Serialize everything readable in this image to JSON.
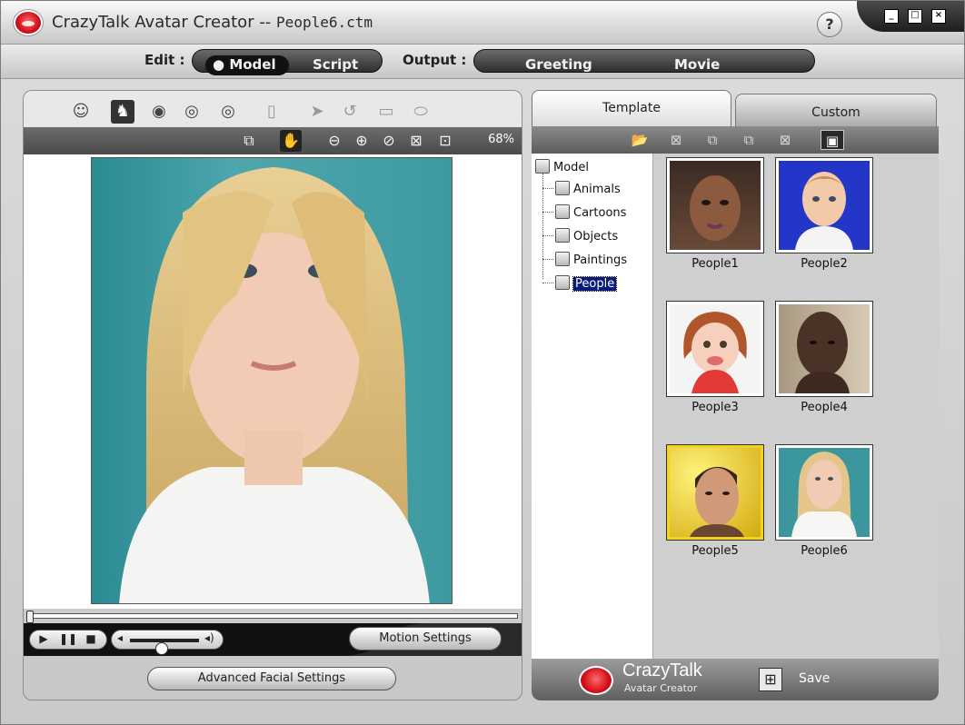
{
  "app": {
    "title_prefix": "CrazyTalk Avatar Creator --",
    "filename": "People6.ctm",
    "help_label": "?",
    "min_label": "_",
    "max_label": "□",
    "close_label": "×"
  },
  "nav": {
    "edit_label": "Edit :",
    "model_label": "Model",
    "script_label": "Script",
    "output_label": "Output :",
    "greeting_label": "Greeting",
    "movie_label": "Movie"
  },
  "editor": {
    "toolbar_icons": [
      "face-icon",
      "face-outline-icon",
      "eye-icon",
      "eyes-icon",
      "eyes-alt-icon",
      "page-icon",
      "cursor-icon",
      "rotate-icon",
      "crop-icon",
      "mouth-icon"
    ],
    "view_icons": [
      "fit-view-icon",
      "hand-icon",
      "zoom-out-icon",
      "zoom-in-icon",
      "reset-icon",
      "fullscreen-icon",
      "center-icon"
    ],
    "zoom_level": "68%",
    "motion_settings_label": "Motion Settings",
    "advanced_label": "Advanced Facial Settings",
    "playback_position": 0.0,
    "volume_level": 0.45
  },
  "library": {
    "tabs": {
      "template": "Template",
      "custom": "Custom"
    },
    "toolbar_icons": [
      "open-folder-icon",
      "delete-doc-icon",
      "copy-icon",
      "paste-icon",
      "remove-icon",
      "view-toggle-icon"
    ],
    "tree": {
      "root": "Model",
      "children": [
        "Animals",
        "Cartoons",
        "Objects",
        "Paintings",
        "People"
      ],
      "selected": "People"
    },
    "items": [
      {
        "label": "People1",
        "palette": "#5a3b2e"
      },
      {
        "label": "People2",
        "palette": "#2436c8"
      },
      {
        "label": "People3",
        "palette": "#f2f2f2"
      },
      {
        "label": "People4",
        "palette": "#4e3a2c"
      },
      {
        "label": "People5",
        "palette": "#e6c21a"
      },
      {
        "label": "People6",
        "palette": "#3b969e"
      }
    ],
    "brand_main": "CrazyTalk",
    "brand_sub": "Avatar Creator",
    "save_label": "Save"
  }
}
